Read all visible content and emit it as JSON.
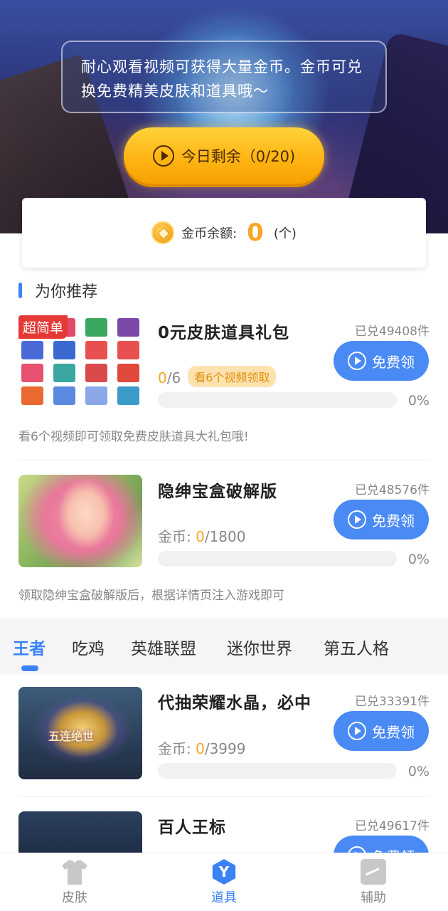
{
  "hero": {
    "notice": "耐心观看视频可获得大量金币。金币可兑换免费精美皮肤和道具哦～",
    "watch_button": "今日剩余（0/20)"
  },
  "balance": {
    "label": "金币余额:",
    "amount": "0",
    "unit": "(个)"
  },
  "section": {
    "title": "为你推荐"
  },
  "items": [
    {
      "name": "0元皮肤道具礼包",
      "redeemed": "已兑49408件",
      "button": "免费领",
      "progress_current": "0",
      "progress_total": "/6",
      "tag": "看6个视频领取",
      "percent": "0%",
      "progress_fraction": 0,
      "desc": "看6个视频即可领取免费皮肤道具大礼包哦!",
      "badge": "超简单"
    },
    {
      "name": "隐绅宝盒破解版",
      "redeemed": "已兑48576件",
      "button": "免费领",
      "coin_label": "金币: ",
      "progress_current": "0",
      "progress_total": "/1800",
      "percent": "0%",
      "progress_fraction": 0,
      "desc": "领取隐绅宝盒破解版后，根据详情页注入游戏即可"
    },
    {
      "name": "代抽荣耀水晶，必中",
      "redeemed": "已兑33391件",
      "button": "免费领",
      "coin_label": "金币: ",
      "progress_current": "0",
      "progress_total": "/3999",
      "percent": "0%",
      "progress_fraction": 0,
      "thumb_caption": "五连绝世"
    },
    {
      "name": "百人王标",
      "redeemed": "已兑49617件",
      "button": "免费领"
    }
  ],
  "tabs": [
    "王者",
    "吃鸡",
    "英雄联盟",
    "迷你世界",
    "第五人格"
  ],
  "bottom_nav": [
    {
      "label": "皮肤",
      "icon": "shirt-icon"
    },
    {
      "label": "道具",
      "icon": "props-hex-icon"
    },
    {
      "label": "辅助",
      "icon": "assist-icon"
    }
  ],
  "colors": {
    "accent": "#3b82f6",
    "button_blue": "#4a8af4",
    "coin_orange": "#f5a623",
    "watch_button": "#ffb514",
    "badge_red": "#e53935"
  }
}
